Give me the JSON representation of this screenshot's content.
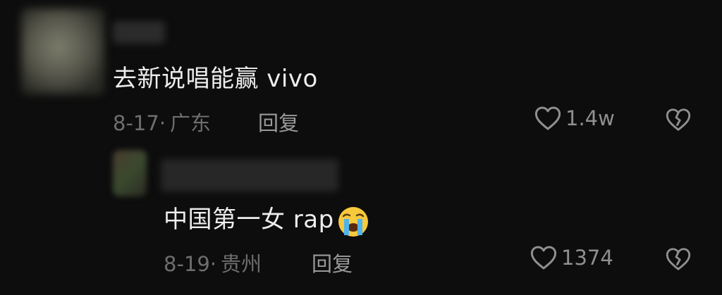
{
  "comments": [
    {
      "text": "去新说唱能赢 vivo",
      "date": "8-17",
      "separator": "·",
      "location": "广东",
      "reply_label": "回复",
      "like_count": "1.4w"
    }
  ],
  "replies": [
    {
      "text": "中国第一女 rap",
      "emoji": "loudly-crying-face",
      "date": "8-19",
      "separator": "·",
      "location": "贵州",
      "reply_label": "回复",
      "like_count": "1374"
    }
  ],
  "icons": {
    "like": "heart-outline-icon",
    "dislike": "broken-heart-icon"
  },
  "colors": {
    "background": "#0d0d0d",
    "text": "#ededed",
    "meta": "#6e6e6e"
  }
}
